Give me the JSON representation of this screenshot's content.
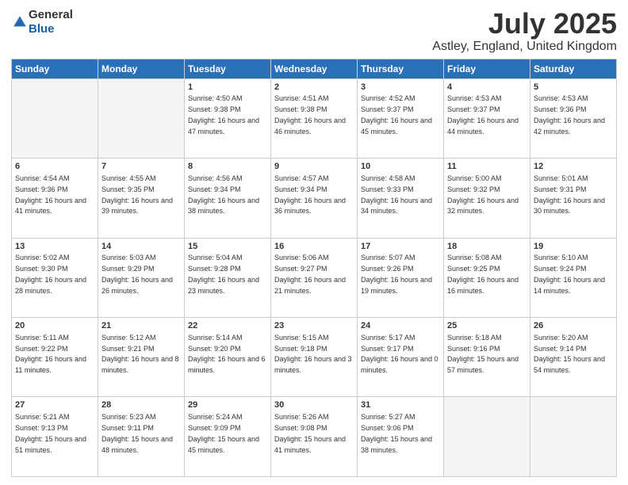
{
  "logo": {
    "general": "General",
    "blue": "Blue"
  },
  "header": {
    "title": "July 2025",
    "subtitle": "Astley, England, United Kingdom"
  },
  "weekdays": [
    "Sunday",
    "Monday",
    "Tuesday",
    "Wednesday",
    "Thursday",
    "Friday",
    "Saturday"
  ],
  "weeks": [
    [
      {
        "day": "",
        "info": ""
      },
      {
        "day": "",
        "info": ""
      },
      {
        "day": "1",
        "info": "Sunrise: 4:50 AM\nSunset: 9:38 PM\nDaylight: 16 hours and 47 minutes."
      },
      {
        "day": "2",
        "info": "Sunrise: 4:51 AM\nSunset: 9:38 PM\nDaylight: 16 hours and 46 minutes."
      },
      {
        "day": "3",
        "info": "Sunrise: 4:52 AM\nSunset: 9:37 PM\nDaylight: 16 hours and 45 minutes."
      },
      {
        "day": "4",
        "info": "Sunrise: 4:53 AM\nSunset: 9:37 PM\nDaylight: 16 hours and 44 minutes."
      },
      {
        "day": "5",
        "info": "Sunrise: 4:53 AM\nSunset: 9:36 PM\nDaylight: 16 hours and 42 minutes."
      }
    ],
    [
      {
        "day": "6",
        "info": "Sunrise: 4:54 AM\nSunset: 9:36 PM\nDaylight: 16 hours and 41 minutes."
      },
      {
        "day": "7",
        "info": "Sunrise: 4:55 AM\nSunset: 9:35 PM\nDaylight: 16 hours and 39 minutes."
      },
      {
        "day": "8",
        "info": "Sunrise: 4:56 AM\nSunset: 9:34 PM\nDaylight: 16 hours and 38 minutes."
      },
      {
        "day": "9",
        "info": "Sunrise: 4:57 AM\nSunset: 9:34 PM\nDaylight: 16 hours and 36 minutes."
      },
      {
        "day": "10",
        "info": "Sunrise: 4:58 AM\nSunset: 9:33 PM\nDaylight: 16 hours and 34 minutes."
      },
      {
        "day": "11",
        "info": "Sunrise: 5:00 AM\nSunset: 9:32 PM\nDaylight: 16 hours and 32 minutes."
      },
      {
        "day": "12",
        "info": "Sunrise: 5:01 AM\nSunset: 9:31 PM\nDaylight: 16 hours and 30 minutes."
      }
    ],
    [
      {
        "day": "13",
        "info": "Sunrise: 5:02 AM\nSunset: 9:30 PM\nDaylight: 16 hours and 28 minutes."
      },
      {
        "day": "14",
        "info": "Sunrise: 5:03 AM\nSunset: 9:29 PM\nDaylight: 16 hours and 26 minutes."
      },
      {
        "day": "15",
        "info": "Sunrise: 5:04 AM\nSunset: 9:28 PM\nDaylight: 16 hours and 23 minutes."
      },
      {
        "day": "16",
        "info": "Sunrise: 5:06 AM\nSunset: 9:27 PM\nDaylight: 16 hours and 21 minutes."
      },
      {
        "day": "17",
        "info": "Sunrise: 5:07 AM\nSunset: 9:26 PM\nDaylight: 16 hours and 19 minutes."
      },
      {
        "day": "18",
        "info": "Sunrise: 5:08 AM\nSunset: 9:25 PM\nDaylight: 16 hours and 16 minutes."
      },
      {
        "day": "19",
        "info": "Sunrise: 5:10 AM\nSunset: 9:24 PM\nDaylight: 16 hours and 14 minutes."
      }
    ],
    [
      {
        "day": "20",
        "info": "Sunrise: 5:11 AM\nSunset: 9:22 PM\nDaylight: 16 hours and 11 minutes."
      },
      {
        "day": "21",
        "info": "Sunrise: 5:12 AM\nSunset: 9:21 PM\nDaylight: 16 hours and 8 minutes."
      },
      {
        "day": "22",
        "info": "Sunrise: 5:14 AM\nSunset: 9:20 PM\nDaylight: 16 hours and 6 minutes."
      },
      {
        "day": "23",
        "info": "Sunrise: 5:15 AM\nSunset: 9:18 PM\nDaylight: 16 hours and 3 minutes."
      },
      {
        "day": "24",
        "info": "Sunrise: 5:17 AM\nSunset: 9:17 PM\nDaylight: 16 hours and 0 minutes."
      },
      {
        "day": "25",
        "info": "Sunrise: 5:18 AM\nSunset: 9:16 PM\nDaylight: 15 hours and 57 minutes."
      },
      {
        "day": "26",
        "info": "Sunrise: 5:20 AM\nSunset: 9:14 PM\nDaylight: 15 hours and 54 minutes."
      }
    ],
    [
      {
        "day": "27",
        "info": "Sunrise: 5:21 AM\nSunset: 9:13 PM\nDaylight: 15 hours and 51 minutes."
      },
      {
        "day": "28",
        "info": "Sunrise: 5:23 AM\nSunset: 9:11 PM\nDaylight: 15 hours and 48 minutes."
      },
      {
        "day": "29",
        "info": "Sunrise: 5:24 AM\nSunset: 9:09 PM\nDaylight: 15 hours and 45 minutes."
      },
      {
        "day": "30",
        "info": "Sunrise: 5:26 AM\nSunset: 9:08 PM\nDaylight: 15 hours and 41 minutes."
      },
      {
        "day": "31",
        "info": "Sunrise: 5:27 AM\nSunset: 9:06 PM\nDaylight: 15 hours and 38 minutes."
      },
      {
        "day": "",
        "info": ""
      },
      {
        "day": "",
        "info": ""
      }
    ]
  ]
}
